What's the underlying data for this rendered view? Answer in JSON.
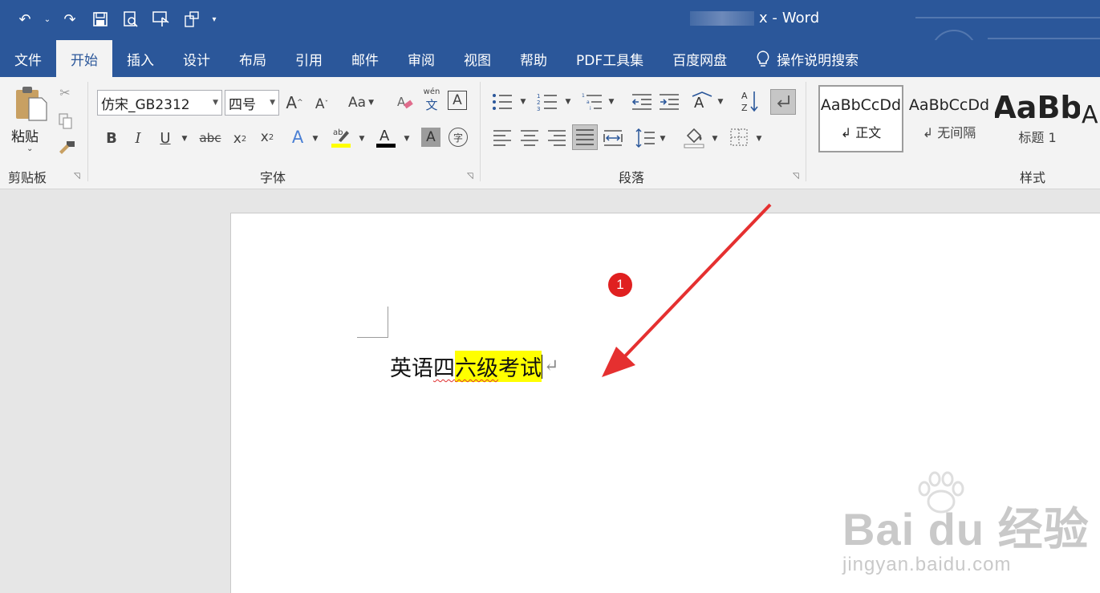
{
  "window": {
    "title_suffix": "x -",
    "app": "Word"
  },
  "tabs": [
    "文件",
    "开始",
    "插入",
    "设计",
    "布局",
    "引用",
    "邮件",
    "审阅",
    "视图",
    "帮助",
    "PDF工具集",
    "百度网盘"
  ],
  "tell_me": "操作说明搜索",
  "clipboard": {
    "paste_label": "粘贴",
    "group_label": "剪贴板"
  },
  "font": {
    "name": "仿宋_GB2312",
    "size": "四号",
    "group_label": "字体",
    "case_label": "Aa"
  },
  "paragraph": {
    "group_label": "段落"
  },
  "styles": {
    "group_label": "样式",
    "items": [
      {
        "preview": "AaBbCcDd",
        "name": "↲ 正文"
      },
      {
        "preview": "AaBbCcDd",
        "name": "↲ 无间隔"
      },
      {
        "preview": "AaBb",
        "name": "标题 1"
      },
      {
        "preview": "A",
        "name": ""
      }
    ]
  },
  "document": {
    "text_plain": "英语",
    "text_squiggle": "四",
    "text_highlight_squiggle": "六级",
    "text_highlight": "考试",
    "para_mark": "↵"
  },
  "annotation": {
    "badge": "1",
    "color": "#e02020"
  },
  "watermark": {
    "brand": "Bai du 经验",
    "url": "jingyan.baidu.com"
  },
  "colors": {
    "ribbon_blue": "#2b579a",
    "highlight": "#ffff00"
  }
}
